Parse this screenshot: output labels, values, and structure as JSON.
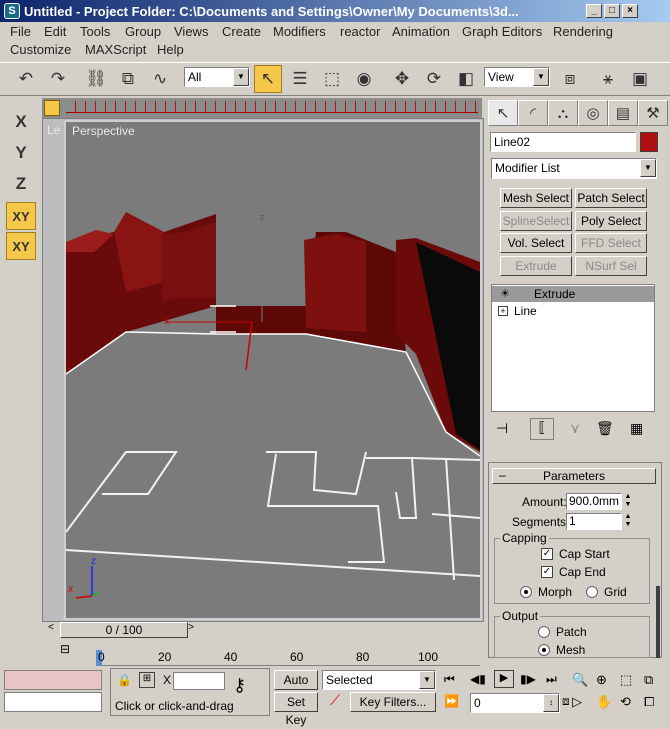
{
  "window": {
    "title": "Untitled     - Project Folder: C:\\Documents and Settings\\Owner\\My Documents\\3d..."
  },
  "menu": [
    "File",
    "Edit",
    "Tools",
    "Group",
    "Views",
    "Create",
    "Modifiers",
    "reactor",
    "Animation",
    "Graph Editors",
    "Rendering",
    "Customize",
    "MAXScript",
    "Help"
  ],
  "toolbar": {
    "selection_filter": "All",
    "view_ref": "View"
  },
  "axes": {
    "x": "X",
    "y": "Y",
    "z": "Z",
    "xy": "XY",
    "xy2": "XY"
  },
  "viewport": {
    "label": "Perspective",
    "corner_label": "Le"
  },
  "command_panel": {
    "object_name": "Line02",
    "object_color": "#b01010",
    "modifier_list": "Modifier List",
    "buttons": [
      "Mesh Select",
      "Patch Select",
      "SplineSelect",
      "Poly Select",
      "Vol. Select",
      "FFD Select",
      "Extrude",
      "NSurf Sel"
    ],
    "stack": [
      "Extrude",
      "Line"
    ],
    "parameters": {
      "title": "Parameters",
      "amount_label": "Amount:",
      "amount": "900.0mm",
      "segments_label": "Segments:",
      "segments": "1",
      "capping_label": "Capping",
      "cap_start": "Cap Start",
      "cap_end": "Cap End",
      "morph": "Morph",
      "grid": "Grid",
      "output_label": "Output",
      "patch": "Patch",
      "mesh": "Mesh"
    }
  },
  "timeline": {
    "frame": "0 / 100",
    "ticks": [
      "0",
      "20",
      "40",
      "60",
      "80",
      "100"
    ]
  },
  "status": {
    "prompt": "Click or click-and-drag",
    "auto_key": "Auto Key",
    "set_key": "Set Key",
    "selected": "Selected",
    "key_filters": "Key Filters...",
    "x_label": "X",
    "frame_field": "0"
  }
}
